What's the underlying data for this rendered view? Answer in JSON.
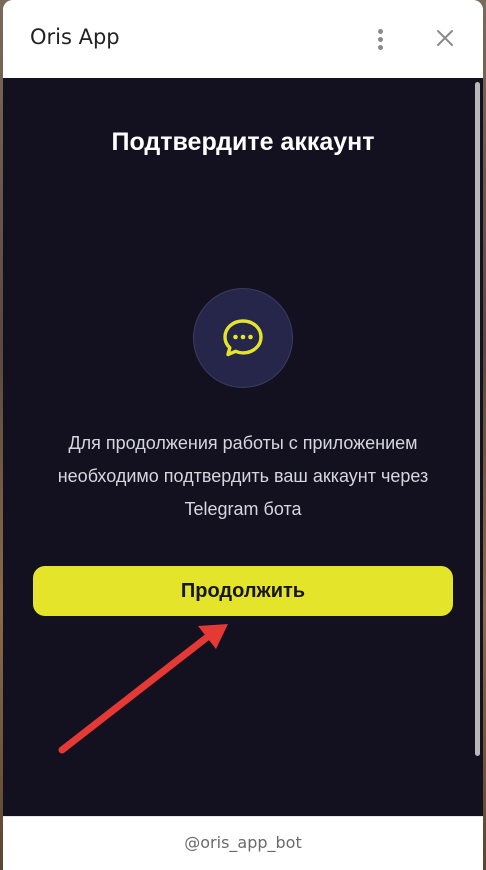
{
  "window": {
    "title": "Oris App",
    "menu_icon": "more-vertical-icon",
    "close_icon": "close-icon"
  },
  "main": {
    "heading": "Подтвердите аккаунт",
    "icon": "chat-bubble-icon",
    "description_lines": [
      "Для продолжения работы с приложением",
      "необходимо подтвердить ваш аккаунт через",
      "Telegram бота"
    ],
    "continue_label": "Продолжить"
  },
  "footer": {
    "bot_handle": "@oris_app_bot"
  },
  "colors": {
    "background": "#13111f",
    "accent": "#e4e52a",
    "icon_circle": "#25264a",
    "annotation_arrow": "#e53935"
  }
}
